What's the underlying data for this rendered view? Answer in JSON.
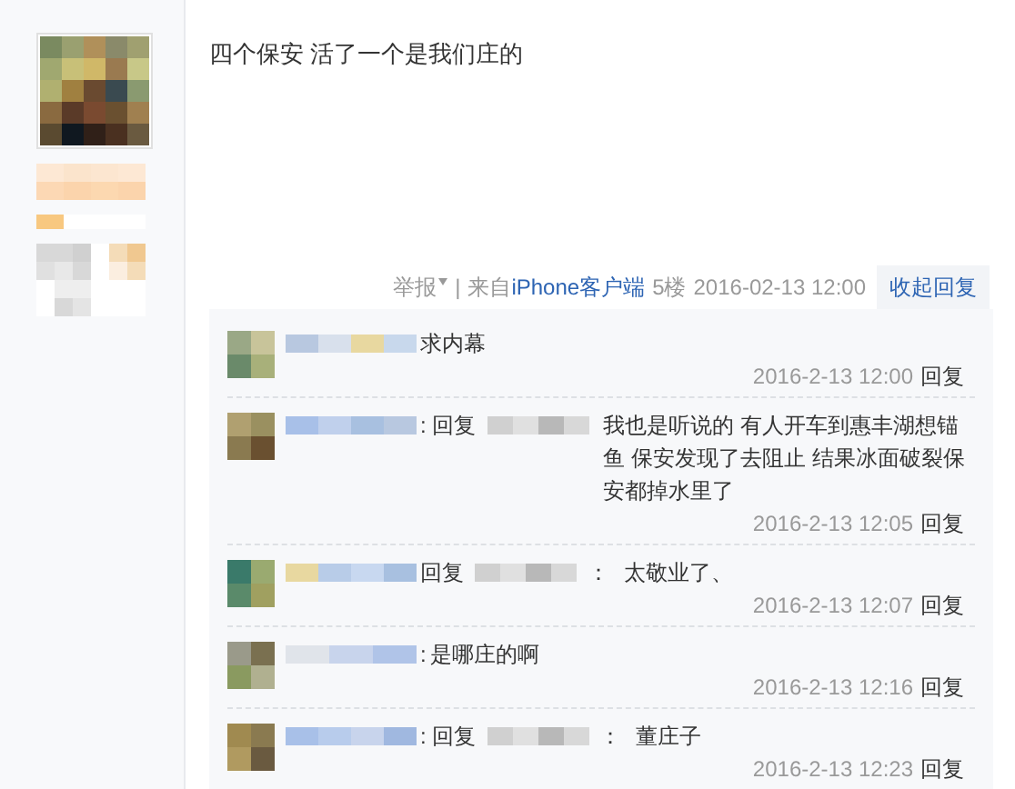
{
  "post": {
    "content": "四个保安 活了一个是我们庄的",
    "tail": {
      "report": "举报",
      "divider": "|",
      "from": "来自",
      "client": "iPhone客户端",
      "floor": "5楼",
      "time": "2016-02-13 12:00",
      "collapse": "收起回复"
    }
  },
  "comments": [
    {
      "kind": "direct",
      "text": "求内幕",
      "time": "2016-2-13 12:00",
      "reply_link": "回复"
    },
    {
      "kind": "reply",
      "lead": ": 回复",
      "text": "我也是听说的 有人开车到惠丰湖想锚鱼 保安发现了去阻止 结果冰面破裂保安都掉水里了",
      "time": "2016-2-13 12:05",
      "reply_link": "回复"
    },
    {
      "kind": "reply",
      "lead": "回复",
      "tail": "：",
      "text": "太敬业了、",
      "time": "2016-2-13 12:07",
      "reply_link": "回复"
    },
    {
      "kind": "direct",
      "lead": ":",
      "text": "是哪庄的啊",
      "time": "2016-2-13 12:16",
      "reply_link": "回复"
    },
    {
      "kind": "reply",
      "lead": ": 回复",
      "tail": "：",
      "text": "董庄子",
      "time": "2016-2-13 12:23",
      "reply_link": "回复"
    }
  ]
}
